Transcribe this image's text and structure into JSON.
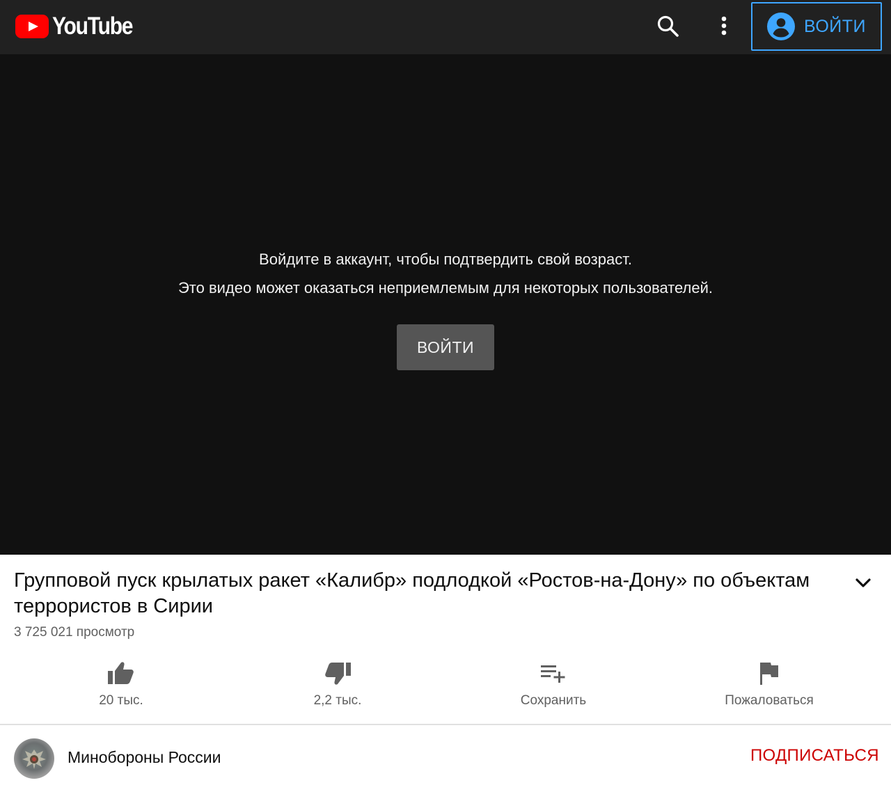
{
  "header": {
    "logo_text": "YouTube",
    "signin_label": "ВОЙТИ"
  },
  "player": {
    "message_line1": "Войдите в аккаунт, чтобы подтвердить свой возраст.",
    "message_line2": "Это видео может оказаться неприемлемым для некоторых пользователей.",
    "signin_label": "ВОЙТИ"
  },
  "video": {
    "title": "Групповой пуск крылатых ракет «Калибр» подлодкой «Ростов-на-Дону» по объектам террористов в Сирии",
    "views": "3 725 021 просмотр"
  },
  "actions": [
    {
      "icon": "thumb-up-icon",
      "label": "20 тыс."
    },
    {
      "icon": "thumb-down-icon",
      "label": "2,2 тыс."
    },
    {
      "icon": "playlist-add-icon",
      "label": "Сохранить"
    },
    {
      "icon": "flag-icon",
      "label": "Пожаловаться"
    }
  ],
  "channel": {
    "name": "Минобороны России",
    "subscribe_label": "ПОДПИСАТЬСЯ"
  },
  "colors": {
    "topbar": "#212121",
    "player": "#111111",
    "accent_blue": "#3ea6ff",
    "brand_red": "#ff0000",
    "subscribe_red": "#cc0000"
  }
}
